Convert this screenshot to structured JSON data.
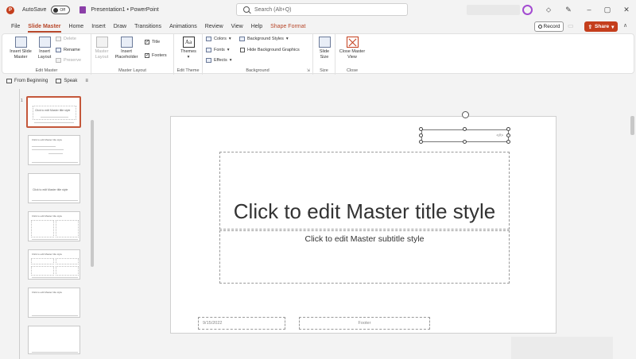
{
  "titlebar": {
    "autosave_label": "AutoSave",
    "autosave_state": "Off",
    "document_title": "Presentation1 • PowerPoint",
    "search_placeholder": "Search (Alt+Q)",
    "app_letter": "P"
  },
  "tabs": [
    "File",
    "Slide Master",
    "Home",
    "Insert",
    "Draw",
    "Transitions",
    "Animations",
    "Review",
    "View",
    "Help",
    "Shape Format"
  ],
  "active_tab": "Slide Master",
  "actions": {
    "record_label": "Record",
    "share_label": "Share"
  },
  "ribbon": {
    "edit_master": {
      "label": "Edit Master",
      "insert_slide_master": "Insert Slide Master",
      "insert_layout": "Insert Layout",
      "delete": "Delete",
      "rename": "Rename",
      "preserve": "Preserve"
    },
    "master_layout": {
      "label": "Master Layout",
      "master_layout_btn": "Master Layout",
      "insert_placeholder": "Insert Placeholder",
      "title_check": "Title",
      "footers_check": "Footers"
    },
    "edit_theme": {
      "label": "Edit Theme",
      "themes": "Themes"
    },
    "background": {
      "label": "Background",
      "colors": "Colors",
      "fonts": "Fonts",
      "effects": "Effects",
      "background_styles": "Background Styles",
      "hide_background_graphics": "Hide Background Graphics"
    },
    "size": {
      "label": "Size",
      "slide_size": "Slide Size"
    },
    "close": {
      "label": "Close",
      "close_master_view": "Close Master View"
    }
  },
  "qat": {
    "from_beginning": "From Beginning",
    "speak": "Speak"
  },
  "thumbnails": {
    "master_title": "Click to edit Master title style",
    "layout_title": "Click to edit Master title style"
  },
  "slide": {
    "title": "Click to edit Master title style",
    "subtitle": "Click to edit Master subtitle style",
    "date": "9/15/2022",
    "footer": "Footer",
    "number": "<#>"
  },
  "colors": {
    "accent": "#b7472a",
    "share": "#c43e1c"
  }
}
